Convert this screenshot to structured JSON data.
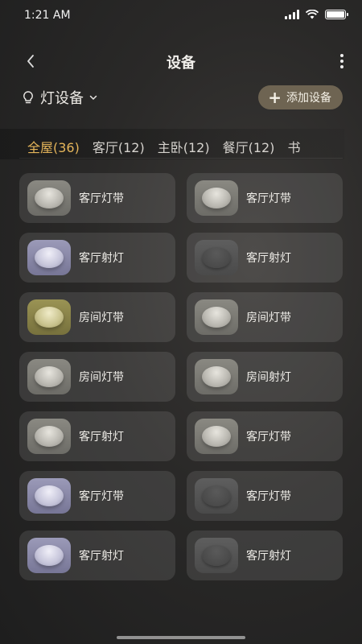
{
  "status_bar": {
    "time": "1:21 AM",
    "battery_level": 1.0
  },
  "nav": {
    "title": "设备"
  },
  "category": {
    "label": "灯设备",
    "add_button_label": "添加设备"
  },
  "tabs": [
    {
      "label": "全屋(36)",
      "active": true
    },
    {
      "label": "客厅(12)",
      "active": false
    },
    {
      "label": "主卧(12)",
      "active": false
    },
    {
      "label": "餐厅(12)",
      "active": false
    },
    {
      "label": "书",
      "active": false
    }
  ],
  "devices": [
    {
      "name": "客厅灯带",
      "state": "on-warm"
    },
    {
      "name": "客厅灯带",
      "state": "on-warm"
    },
    {
      "name": "客厅射灯",
      "state": "on-blue"
    },
    {
      "name": "客厅射灯",
      "state": "off"
    },
    {
      "name": "房间灯带",
      "state": "on-gold"
    },
    {
      "name": "房间灯带",
      "state": "on-warm"
    },
    {
      "name": "房间灯带",
      "state": "on-warm"
    },
    {
      "name": "房间射灯",
      "state": "on-warm"
    },
    {
      "name": "客厅射灯",
      "state": "on-warm"
    },
    {
      "name": "客厅灯带",
      "state": "on-warm"
    },
    {
      "name": "客厅灯带",
      "state": "on-blue"
    },
    {
      "name": "客厅灯带",
      "state": "off"
    },
    {
      "name": "客厅射灯",
      "state": "on-blue"
    },
    {
      "name": "客厅射灯",
      "state": "off"
    }
  ],
  "colors": {
    "accent": "#e5b55a",
    "add_button_bg": "#6e6452"
  },
  "icons": {
    "back": "chevron-left-icon",
    "more": "more-vertical-icon",
    "bulb": "bulb-icon",
    "dropdown": "chevron-down-icon",
    "add": "plus-icon"
  }
}
